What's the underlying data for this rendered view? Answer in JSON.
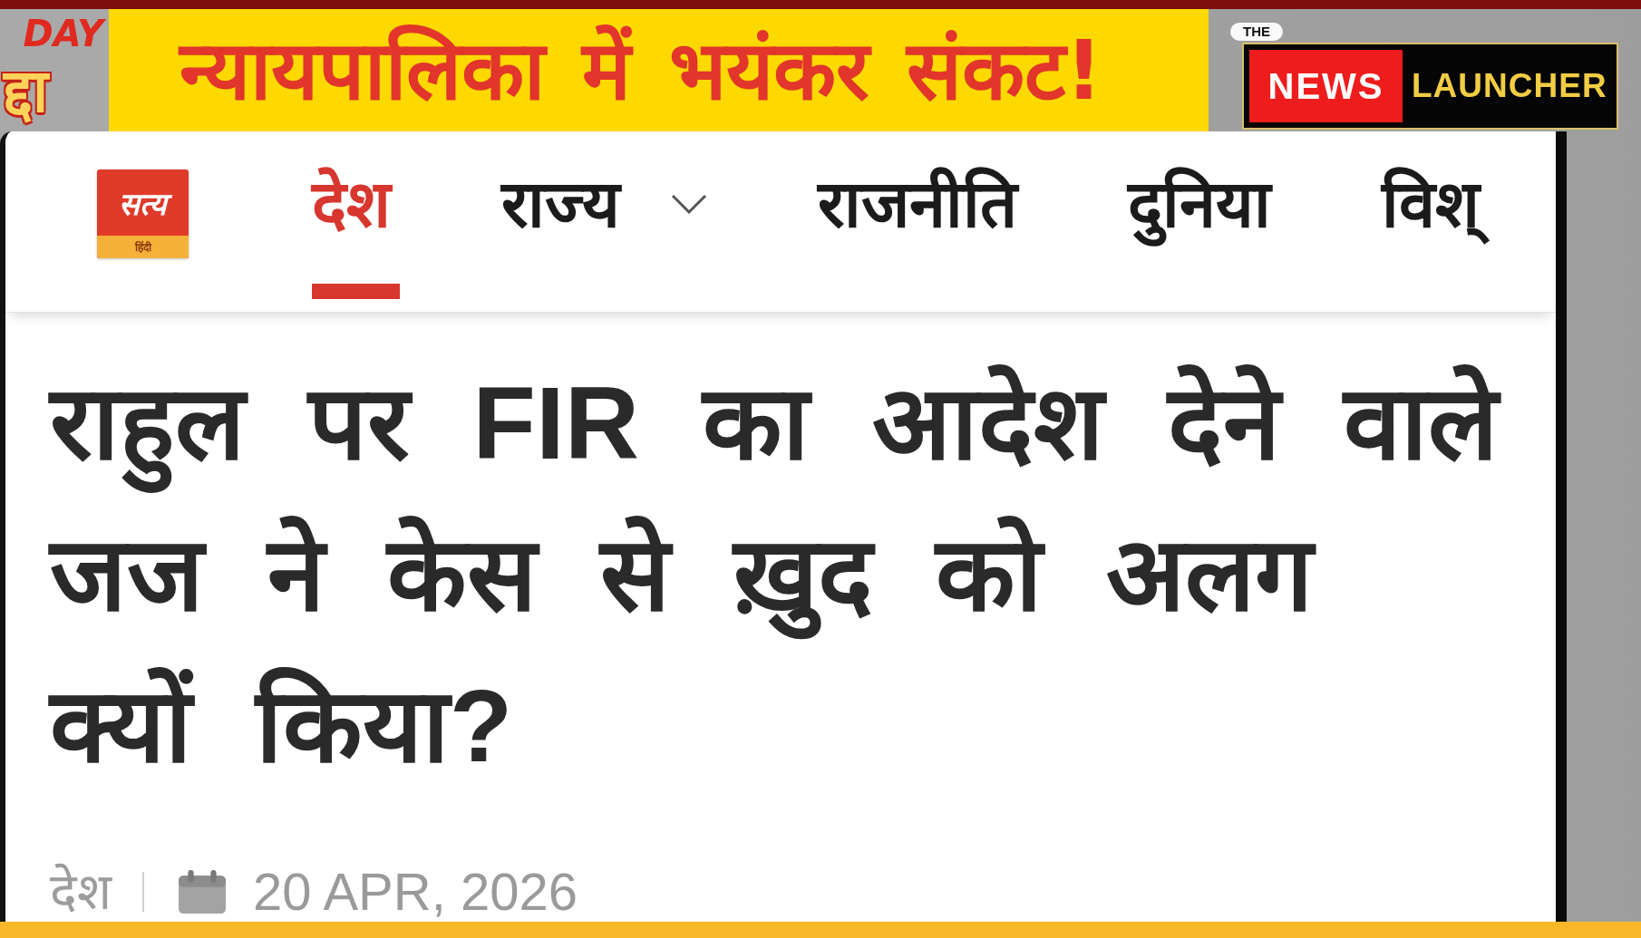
{
  "broadcast": {
    "corner_label": {
      "line_1": "DAY",
      "line_2": "द्दा"
    },
    "banner": {
      "headline": "न्यायपालिका में भयंकर संकट!"
    },
    "channel_logo": {
      "prefix": "THE",
      "word_1": "NEWS",
      "word_2": "LAUNCHER"
    }
  },
  "site": {
    "logo": {
      "name": "सत्य",
      "tagline": "हिंदी"
    },
    "nav": [
      {
        "label": "देश",
        "selected": true,
        "dropdown": false
      },
      {
        "label": "राज्य",
        "selected": false,
        "dropdown": true
      },
      {
        "label": "राजनीति",
        "selected": false,
        "dropdown": false
      },
      {
        "label": "दुनिया",
        "selected": false,
        "dropdown": false
      },
      {
        "label": "विश्",
        "selected": false,
        "dropdown": false
      }
    ]
  },
  "article": {
    "title": "राहुल पर FIR का आदेश देने वाले जज ने केस से ख़ुद को अलग क्यों किया?",
    "category": "देश",
    "date": "20 APR, 2026"
  }
}
